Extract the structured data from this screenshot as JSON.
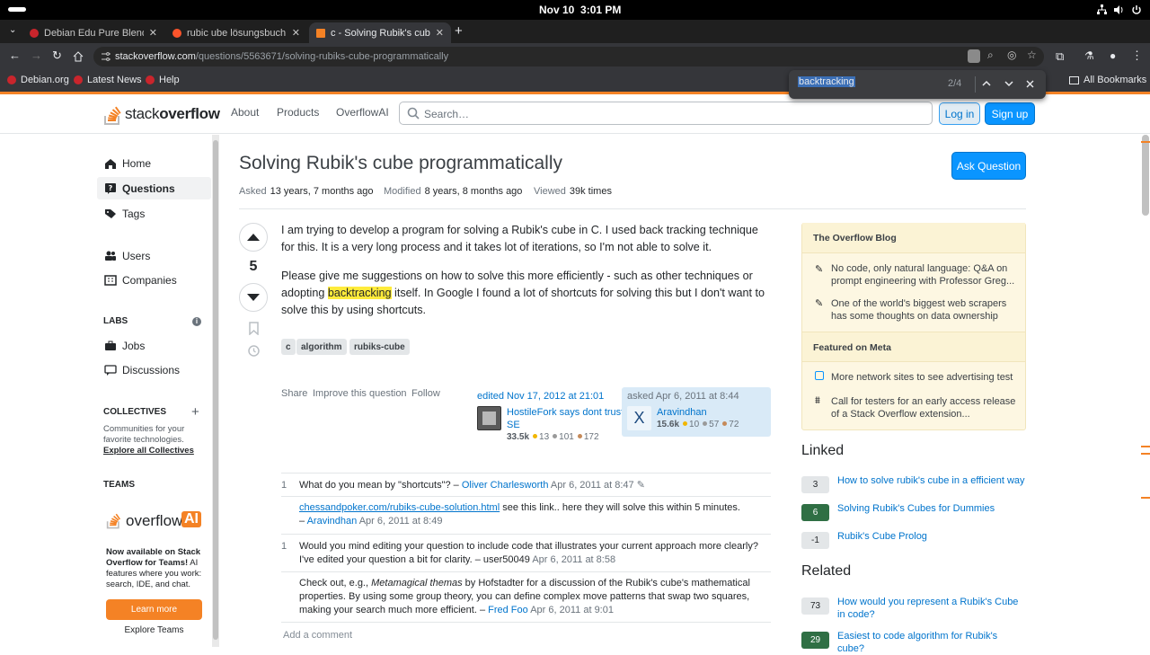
{
  "system": {
    "date": "Nov 10",
    "time": "3:01 PM"
  },
  "tabs": [
    {
      "label": "Debian Edu Pure Blend"
    },
    {
      "label": "rubic ube lösungsbuch at"
    },
    {
      "label": "c - Solving Rubik's cube p"
    }
  ],
  "address": {
    "domain": "stackoverflow.com",
    "path": "/questions/5563671/solving-rubiks-cube-programmatically"
  },
  "bookmarks": {
    "items": [
      "Debian.org",
      "Latest News",
      "Help"
    ],
    "all": "All Bookmarks"
  },
  "find": {
    "query": "backtracking",
    "count": "2/4"
  },
  "header": {
    "logo_text_a": "stack",
    "logo_text_b": "overflow",
    "nav": [
      "About",
      "Products",
      "OverflowAI"
    ],
    "search_placeholder": "Search…",
    "login": "Log in",
    "signup": "Sign up"
  },
  "leftnav": {
    "items": [
      "Home",
      "Questions",
      "Tags",
      "Users",
      "Companies"
    ],
    "labs": "LABS",
    "labs_items": [
      "Jobs",
      "Discussions"
    ],
    "collectives": "COLLECTIVES",
    "collectives_desc": "Communities for your favorite technologies.",
    "collectives_link": "Explore all Collectives",
    "teams": "TEAMS",
    "teams_logo_a": "overflow",
    "teams_logo_b": "AI",
    "teams_desc_bold": "Now available on Stack Overflow for Teams!",
    "teams_desc": " AI features where you work: search, IDE, and chat.",
    "learn_more": "Learn more",
    "explore_teams": "Explore Teams"
  },
  "question": {
    "title": "Solving Rubik's cube programmatically",
    "ask_button": "Ask Question",
    "asked_label": "Asked",
    "asked": "13 years, 7 months ago",
    "modified_label": "Modified",
    "modified": "8 years, 8 months ago",
    "viewed_label": "Viewed",
    "viewed": "39k times",
    "votes": "5",
    "para1": "I am trying to develop a program for solving a Rubik's cube in C. I used back tracking technique for this. It is a very long process and it takes lot of iterations, so I'm not able to solve it.",
    "para2_a": "Please give me suggestions on how to solve this more efficiently - such as other techniques or adopting ",
    "para2_mark": "backtracking",
    "para2_b": " itself. In Google I found a lot of shortcuts for solving this but I don't want to solve this by using shortcuts.",
    "tags": [
      "c",
      "algorithm",
      "rubiks-cube"
    ],
    "menu": [
      "Share",
      "Improve this question",
      "Follow"
    ],
    "editor": {
      "label": "edited Nov 17, 2012 at 21:01",
      "name": "HostileFork says dont trust SE",
      "rep": "33.5k",
      "gold": "13",
      "silver": "101",
      "bronze": "172"
    },
    "asker": {
      "label": "asked Apr 6, 2011 at 8:44",
      "name": "Aravindhan",
      "avatar_letter": "X",
      "rep": "15.6k",
      "gold": "10",
      "silver": "57",
      "bronze": "72"
    }
  },
  "comments": [
    {
      "score": "1",
      "text": "What do you mean by \"shortcuts\"? – ",
      "user": "Oliver Charlesworth",
      "date": "Apr 6, 2011 at 8:47"
    },
    {
      "score": "",
      "link": "chessandpoker.com/rubiks-cube-solution.html",
      "text": " see this link.. here they will solve this within 5 minutes.",
      "dash": "– ",
      "user": "Aravindhan",
      "date": "Apr 6, 2011 at 8:49"
    },
    {
      "score": "1",
      "text": "Would you mind editing your question to include code that illustrates your current approach more clearly? I've edited your question a bit for clarity. – user50049 ",
      "date": "Apr 6, 2011 at 8:58"
    },
    {
      "score": "",
      "text_a": "Check out, e.g., ",
      "italic": "Metamagical themas",
      "text_b": " by Hofstadter for a discussion of the Rubik's cube's mathematical properties. By using some group theory, you can define complex move patterns that swap two squares, making your search much more efficient. – ",
      "user": "Fred Foo",
      "date": "Apr 6, 2011 at 9:01"
    }
  ],
  "add_comment": "Add a comment",
  "blog": {
    "title": "The Overflow Blog",
    "items": [
      "No code, only natural language: Q&A on prompt engineering with Professor Greg...",
      "One of the world's biggest web scrapers has some thoughts on data ownership"
    ],
    "meta_title": "Featured on Meta",
    "meta_items": [
      "More network sites to see advertising test",
      "Call for testers for an early access release of a Stack Overflow extension..."
    ]
  },
  "linked": {
    "title": "Linked",
    "items": [
      {
        "count": "3",
        "text": "How to solve rubik's cube in a efficient way"
      },
      {
        "count": "6",
        "text": "Solving Rubik's Cubes for Dummies"
      },
      {
        "count": "-1",
        "text": "Rubik's Cube Prolog"
      }
    ]
  },
  "related": {
    "title": "Related",
    "items": [
      {
        "count": "73",
        "text": "How would you represent a Rubik's Cube in code?"
      },
      {
        "count": "29",
        "text": "Easiest to code algorithm for Rubik's cube?"
      }
    ]
  },
  "colors": {
    "accent": "#f48225",
    "link": "#0074cc",
    "button": "#0a95ff",
    "highlight": "#ffeb3b"
  }
}
